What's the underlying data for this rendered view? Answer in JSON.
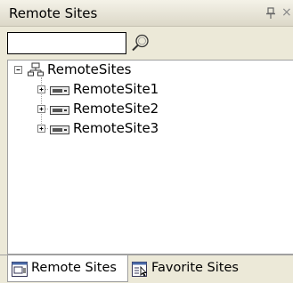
{
  "panel": {
    "title": "Remote Sites",
    "pin_glyph": "Ѩ",
    "close_glyph": "×"
  },
  "search": {
    "value": "",
    "placeholder": "",
    "button_icon": "search-icon"
  },
  "tree": {
    "root": {
      "label": "RemoteSites",
      "icon": "network-sites-icon",
      "expanded": true
    },
    "children": [
      {
        "label": "RemoteSite1",
        "icon": "server-icon",
        "expanded": false
      },
      {
        "label": "RemoteSite2",
        "icon": "server-icon",
        "expanded": false
      },
      {
        "label": "RemoteSite3",
        "icon": "server-icon",
        "expanded": false
      }
    ]
  },
  "tabs": [
    {
      "label": "Remote Sites",
      "icon": "remote-sites-tab-icon",
      "active": true
    },
    {
      "label": "Favorite Sites",
      "icon": "favorite-sites-tab-icon",
      "active": false
    }
  ]
}
